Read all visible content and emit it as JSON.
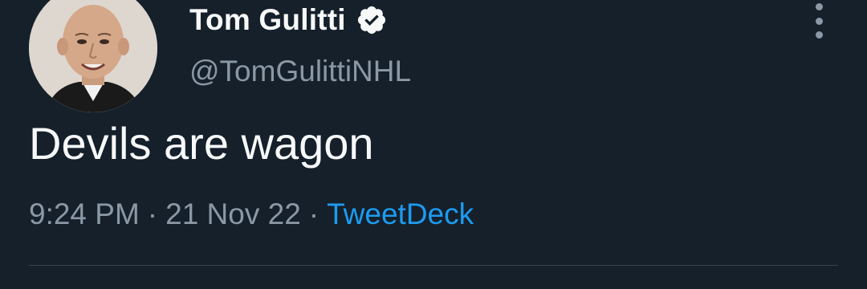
{
  "tweet": {
    "author": {
      "display_name": "Tom Gulitti",
      "handle": "@TomGulittiNHL",
      "verified": true
    },
    "text": "Devils are wagon",
    "time": "9:24 PM",
    "separator": "·",
    "date": "21 Nov 22",
    "source": "TweetDeck"
  },
  "colors": {
    "background": "#15202b",
    "primary_text": "#f7f9f9",
    "secondary_text": "#8b98a5",
    "link": "#1d9bf0",
    "divider": "#38444d"
  },
  "icons": {
    "verified": "verified-badge-icon",
    "more": "more-options-icon"
  }
}
